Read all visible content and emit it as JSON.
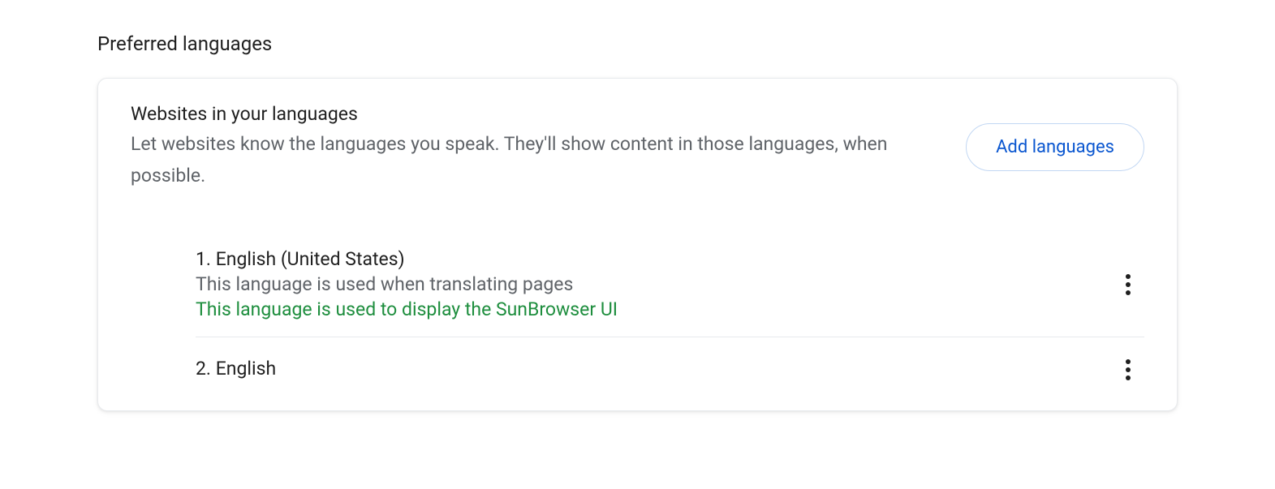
{
  "section": {
    "title": "Preferred languages"
  },
  "card": {
    "subtitle": "Websites in your languages",
    "description": "Let websites know the languages you speak. They'll show content in those languages, when possible.",
    "addButton": "Add languages"
  },
  "languages": [
    {
      "label": "1. English (United States)",
      "translationNote": "This language is used when translating pages",
      "uiNote": "This language is used to display the SunBrowser UI"
    },
    {
      "label": "2. English"
    }
  ]
}
